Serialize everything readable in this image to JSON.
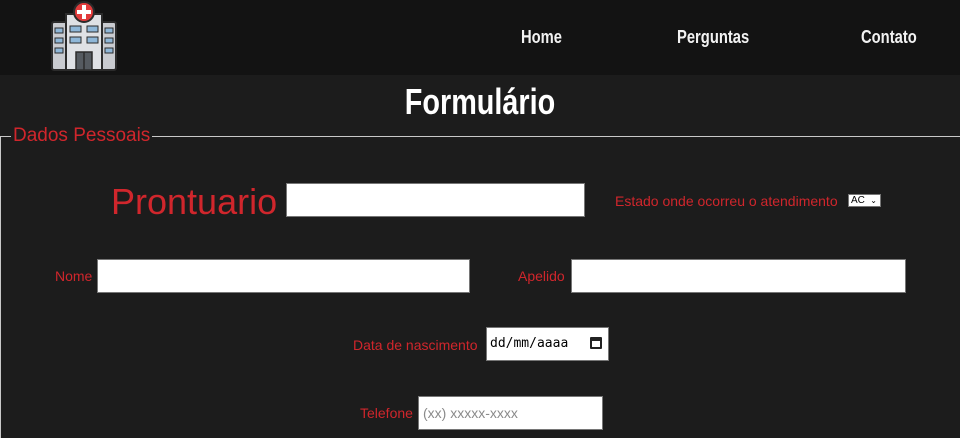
{
  "navbar": {
    "logo_icon": "hospital-icon",
    "links": [
      {
        "label": "Home"
      },
      {
        "label": "Perguntas"
      },
      {
        "label": "Contato"
      }
    ]
  },
  "page": {
    "title": "Formulário"
  },
  "form": {
    "legend": "Dados Pessoais",
    "prontuario": {
      "label": "Prontuario",
      "value": ""
    },
    "estado": {
      "label": "Estado onde ocorreu o atendimento",
      "selected": "AC"
    },
    "nome": {
      "label": "Nome",
      "value": ""
    },
    "apelido": {
      "label": "Apelido",
      "value": ""
    },
    "nascimento": {
      "label": "Data de nascimento",
      "placeholder": "dd/mm/aaaa"
    },
    "telefone": {
      "label": "Telefone",
      "placeholder": "(xx) xxxxx-xxxx"
    }
  },
  "colors": {
    "background": "#1c1c1c",
    "navbar": "#131313",
    "accent": "#d0262c",
    "title": "#ffffff"
  }
}
